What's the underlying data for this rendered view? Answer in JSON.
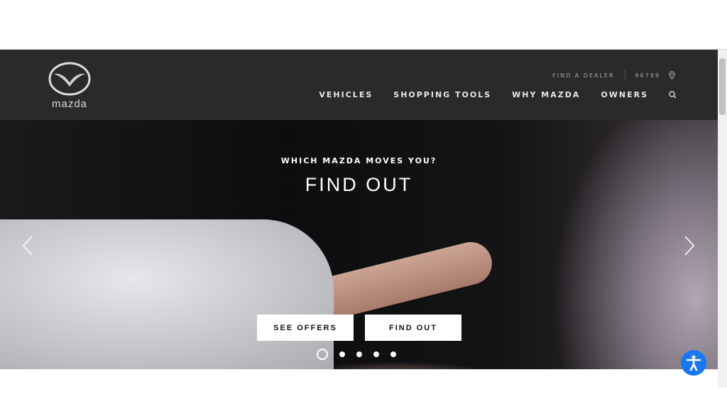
{
  "header": {
    "logo_text": "mazda",
    "utility": {
      "find_dealer": "FIND A DEALER",
      "zip": "96799"
    },
    "nav": [
      {
        "label": "VEHICLES"
      },
      {
        "label": "SHOPPING TOOLS"
      },
      {
        "label": "WHY MAZDA"
      },
      {
        "label": "OWNERS"
      }
    ]
  },
  "hero": {
    "eyebrow": "WHICH MAZDA MOVES YOU?",
    "headline": "FIND OUT",
    "buttons": [
      {
        "label": "SEE OFFERS"
      },
      {
        "label": "FIND OUT"
      }
    ],
    "slides_total": 5,
    "active_slide": 1
  },
  "colors": {
    "header_bg": "#2a2a2a",
    "accessibility_button": "#1877f2"
  },
  "icons": [
    "location-pin-icon",
    "search-icon",
    "chevron-left-icon",
    "chevron-right-icon",
    "accessibility-icon"
  ]
}
